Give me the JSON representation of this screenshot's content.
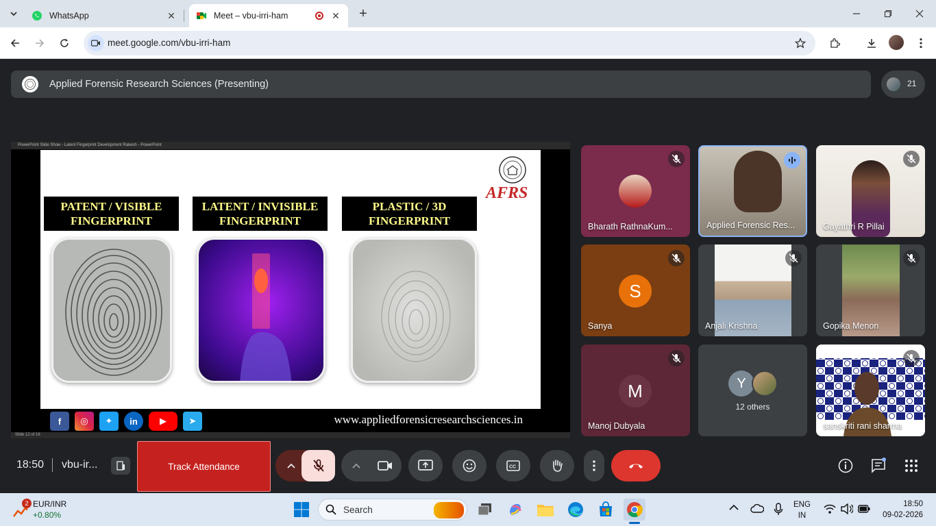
{
  "browser": {
    "tabs": [
      {
        "title": "WhatsApp",
        "active": false
      },
      {
        "title": "Meet – vbu-irri-ham",
        "active": true
      }
    ],
    "url": "meet.google.com/vbu-irri-ham"
  },
  "meet": {
    "presenting_label": "Applied Forensic Research Sciences (Presenting)",
    "participant_count": "21",
    "clock": "18:50",
    "meeting_code": "vbu-ir...",
    "track_attendance": "Track Attendance"
  },
  "presentation": {
    "window_title": "PowerPoint Slide Show - Latent Fingerprint Development Rakesh - PowerPoint",
    "logo_text": "AFRS",
    "panels": [
      {
        "heading_line1": "PATENT / VISIBLE",
        "heading_line2": "FINGERPRINT"
      },
      {
        "heading_line1": "LATENT / INVISIBLE",
        "heading_line2": "FINGERPRINT"
      },
      {
        "heading_line1": "PLASTIC / 3D",
        "heading_line2": "FINGERPRINT"
      }
    ],
    "website": "www.appliedforensicresearchsciences.in",
    "social": [
      "f",
      "ig",
      "tw",
      "in",
      "yt",
      "tg"
    ],
    "status_text": "Slide 12 of 16"
  },
  "participants": [
    {
      "name": "Bharath RathnaKum...",
      "muted": true,
      "avatar": "photo"
    },
    {
      "name": "Applied Forensic Res...",
      "muted": false,
      "speaking": true,
      "avatar": "video"
    },
    {
      "name": "Gayathri R Pillai",
      "muted": true,
      "avatar": "video"
    },
    {
      "name": "Sanya",
      "muted": true,
      "avatar_letter": "S"
    },
    {
      "name": "Anjali Krishna",
      "muted": true,
      "avatar": "video"
    },
    {
      "name": "Gopika Menon",
      "muted": true,
      "avatar": "video"
    },
    {
      "name": "Manoj Dubyala",
      "muted": true,
      "avatar_letter": "M"
    },
    {
      "name": "12 others",
      "avatar_letter": "Y"
    },
    {
      "name": "sanskriti rani sharma",
      "muted": true,
      "avatar": "video"
    }
  ],
  "taskbar": {
    "widget_badge": "2",
    "widget_title": "EUR/INR",
    "widget_value": "+0.80%",
    "search_placeholder": "Search",
    "lang_line1": "ENG",
    "lang_line2": "IN",
    "time": "18:50",
    "date": "09-02-2026"
  }
}
